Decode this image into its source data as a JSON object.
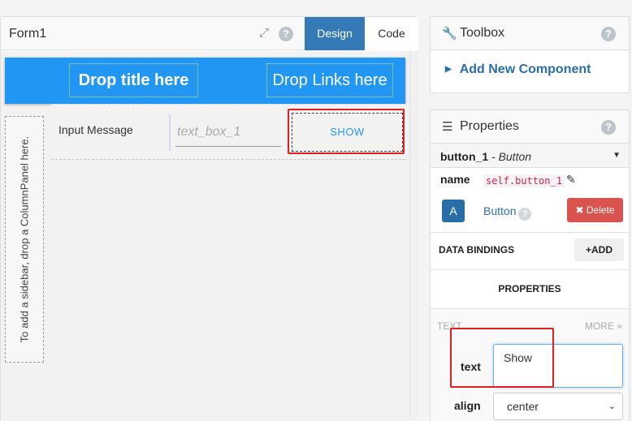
{
  "designer": {
    "form_title": "Form1",
    "tabs": {
      "design": "Design",
      "code": "Code"
    },
    "drop_title": "Drop title here",
    "drop_links": "Drop Links here",
    "sidebar_hint": "To add a sidebar, drop a ColumnPanel here.",
    "input_label": "Input Message",
    "text_box_placeholder": "text_box_1",
    "show_button": "SHOW"
  },
  "toolbox": {
    "title": "Toolbox",
    "add_component": "Add New Component"
  },
  "properties": {
    "title": "Properties",
    "component_name": "button_1",
    "component_type": "- Button",
    "name_label": "name",
    "name_value": "self.button_1",
    "a_button": "A",
    "button_label": "Button",
    "delete_label": "Delete",
    "data_bindings": "DATA BINDINGS",
    "add_label": "ADD",
    "properties_heading": "PROPERTIES",
    "text_section": "TEXT",
    "more_label": "MORE",
    "text_field_label": "text",
    "text_value": "Show",
    "align_label": "align",
    "align_value": "center"
  },
  "colors": {
    "accent": "#337ab7",
    "title_bar": "#2196f3",
    "delete": "#d9534f",
    "highlight": "#e02020"
  }
}
